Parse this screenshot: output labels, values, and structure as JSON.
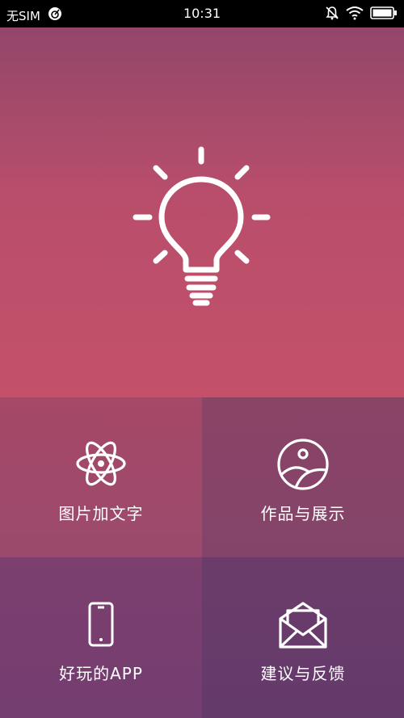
{
  "status_bar": {
    "carrier": "无SIM",
    "time": "10:31"
  },
  "menu": {
    "items": [
      {
        "label": "图片加文字",
        "icon": "atom-icon"
      },
      {
        "label": "作品与展示",
        "icon": "gallery-icon"
      },
      {
        "label": "好玩的APP",
        "icon": "phone-icon"
      },
      {
        "label": "建议与反馈",
        "icon": "mail-icon"
      }
    ]
  },
  "colors": {
    "hero_top": "#93466a",
    "hero_bottom": "#c4506a",
    "tile_1": "#a64867",
    "tile_2": "#8a4466",
    "tile_3": "#7c3f6e",
    "tile_4": "#6b3c6a"
  }
}
